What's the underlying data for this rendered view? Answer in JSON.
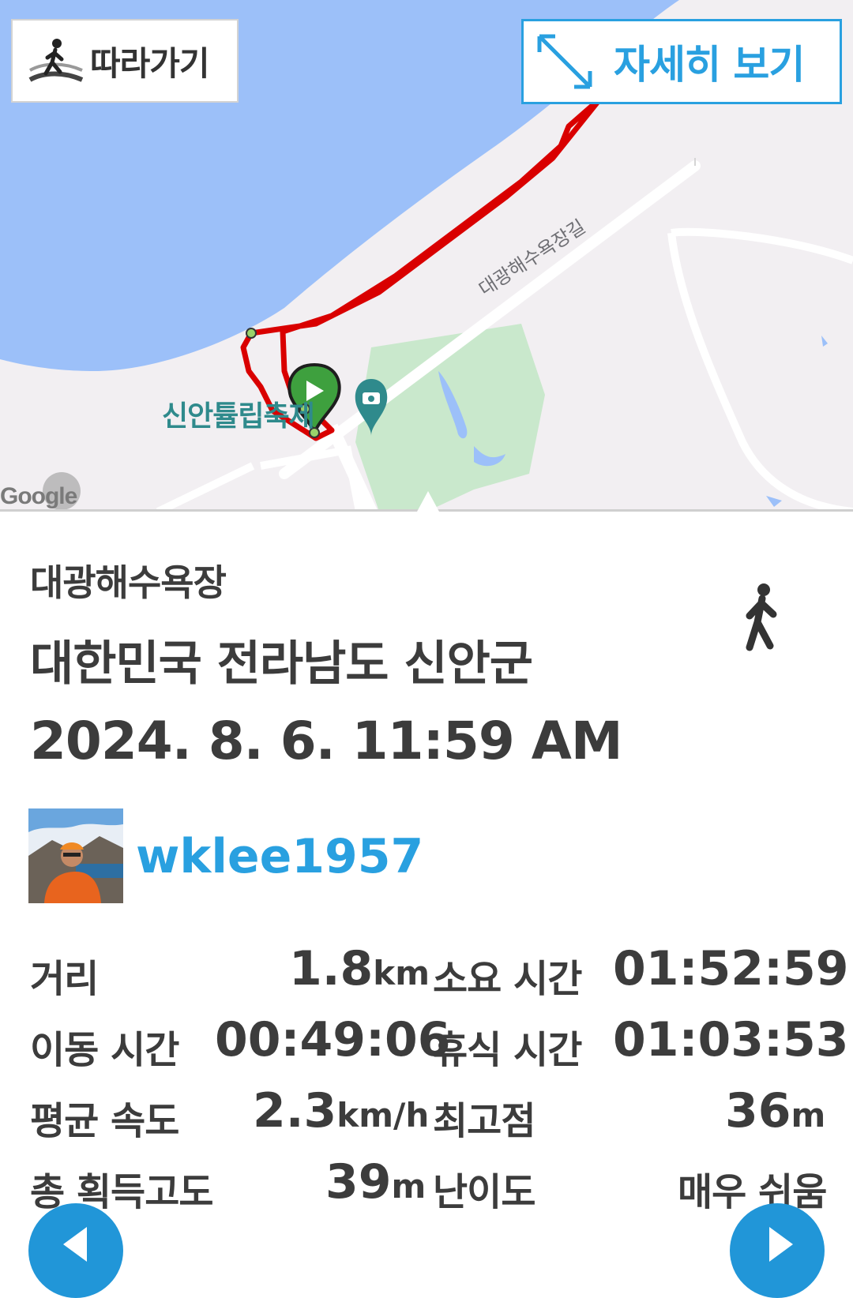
{
  "map": {
    "follow_button_label": "따라가기",
    "detail_button_label": "자세히 보기",
    "street_label": "대광해수욕장길",
    "poi_label": "신안튤립축제",
    "logo": "Google",
    "colors": {
      "water": "#9cc0f9",
      "track": "#d90000",
      "park": "#c9e8cc",
      "start_marker": "#3ea03e"
    }
  },
  "info": {
    "place_name": "대광해수욕장",
    "region": "대한민국 전라남도 신안군",
    "datetime": "2024. 8. 6. 11:59 AM",
    "activity_icon": "walk-icon",
    "username": "wklee1957"
  },
  "stats": {
    "distance": {
      "label": "거리",
      "value": "1.8",
      "unit": "km"
    },
    "duration": {
      "label": "소요 시간",
      "value": "01:52:59"
    },
    "moving_time": {
      "label": "이동 시간",
      "value": "00:49:06"
    },
    "rest_time": {
      "label": "휴식 시간",
      "value": "01:03:53"
    },
    "avg_speed": {
      "label": "평균 속도",
      "value": "2.3",
      "unit": "km/h"
    },
    "max_elevation": {
      "label": "최고점",
      "value": "36",
      "unit": "m"
    },
    "total_ascent": {
      "label": "총 획득고도",
      "value": "39",
      "unit": "m"
    },
    "difficulty": {
      "label": "난이도",
      "value": "매우 쉬움"
    }
  },
  "accent_color": "#29a0e0"
}
